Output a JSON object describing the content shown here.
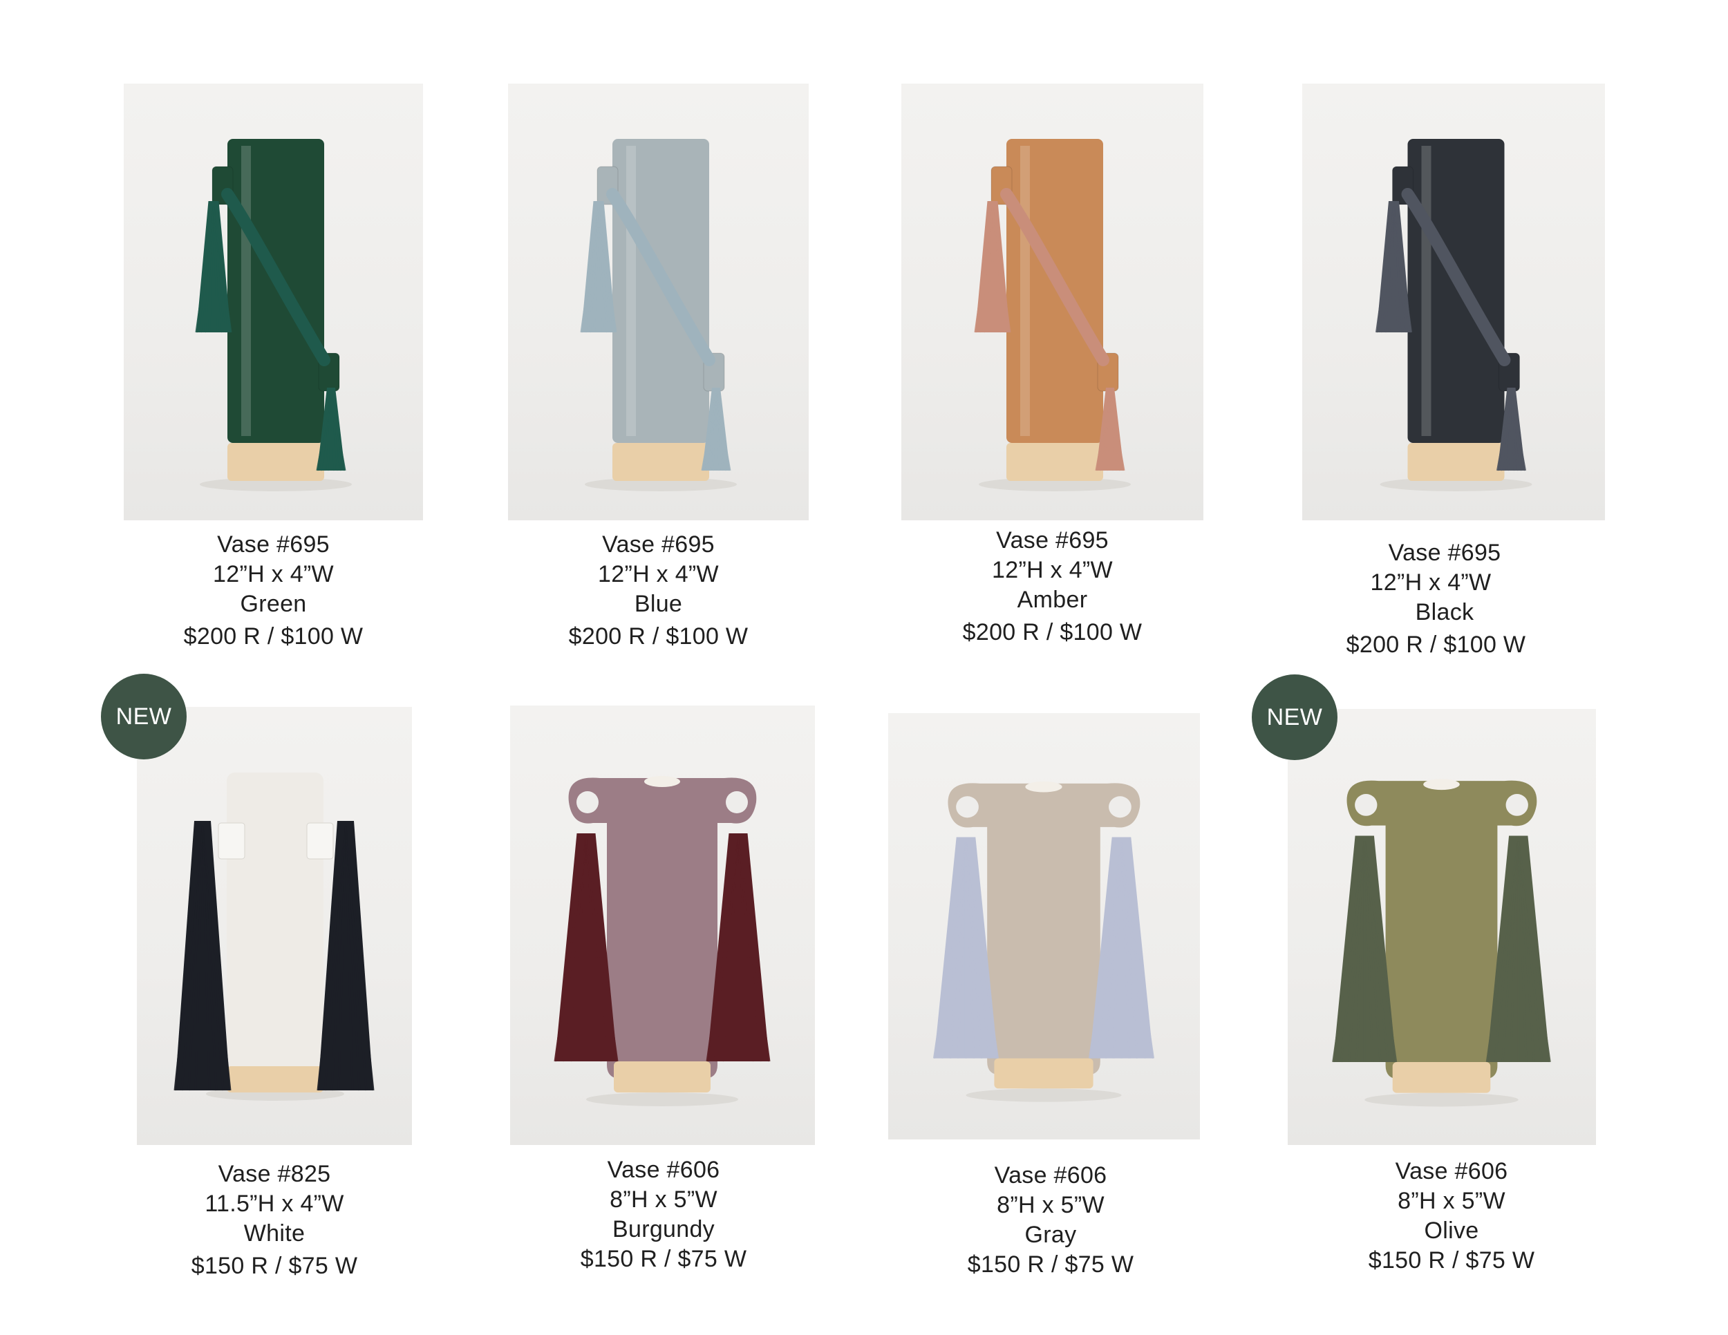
{
  "products": [
    {
      "name": "Vase #695",
      "size": "12”H x 4”W",
      "color": "Green",
      "price": "$200 R / $100 W",
      "glaze": "#1f4a35",
      "tassel": "#1f5a4c"
    },
    {
      "name": "Vase #695",
      "size": "12”H x 4”W",
      "color": "Blue",
      "price": "$200 R / $100 W",
      "glaze": "#a9b4b8",
      "tassel": "#9fb3bd"
    },
    {
      "name": "Vase #695",
      "size": "12”H x 4”W",
      "color": "Amber",
      "price": "$200 R / $100 W",
      "glaze": "#c98a58",
      "tassel": "#c98e7a"
    },
    {
      "name": "Vase #695",
      "size": "12”H x 4”W",
      "color": "Black",
      "price": "$200 R / $100 W",
      "glaze": "#2e3238",
      "tassel": "#505560"
    },
    {
      "name": "Vase #825",
      "size": "11.5”H x 4”W",
      "color": "White",
      "price": "$150 R / $75 W",
      "glaze": "#eeebe6",
      "tassel": "#1c1f26",
      "badge": "NEW"
    },
    {
      "name": "Vase #606",
      "size": "8”H x 5”W",
      "color": "Burgundy",
      "price": "$150 R / $75 W",
      "glaze": "#9c7d86",
      "tassel": "#5a1e24"
    },
    {
      "name": "Vase #606",
      "size": "8”H x 5”W",
      "color": "Gray",
      "price": "$150 R / $75 W",
      "glaze": "#c9bcae",
      "tassel": "#b9bfd4"
    },
    {
      "name": "Vase #606",
      "size": "8”H x 5”W",
      "color": "Olive",
      "price": "$150 R / $75 W",
      "glaze": "#8e8a5c",
      "tassel": "#57614a",
      "badge": "NEW"
    }
  ],
  "accent": "#3e5446"
}
